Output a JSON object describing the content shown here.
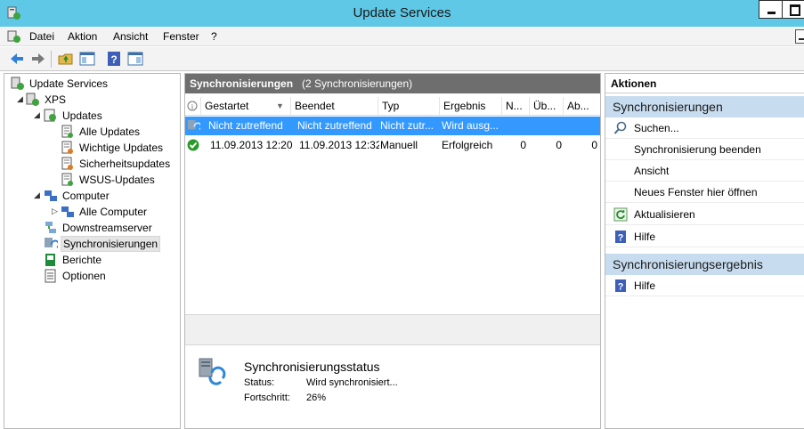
{
  "window": {
    "title": "Update Services"
  },
  "menu": [
    "Datei",
    "Aktion",
    "Ansicht",
    "Fenster",
    "?"
  ],
  "tree": {
    "root": "Update Services",
    "server": "XPS",
    "updates": "Updates",
    "update_children": [
      "Alle Updates",
      "Wichtige Updates",
      "Sicherheitsupdates",
      "WSUS-Updates"
    ],
    "computer": "Computer",
    "computer_children": [
      "Alle Computer"
    ],
    "downstream": "Downstreamserver",
    "sync": "Synchronisierungen",
    "reports": "Berichte",
    "options": "Optionen"
  },
  "center": {
    "title": "Synchronisierungen",
    "count": "(2 Synchronisierungen)",
    "columns": [
      "Gestartet",
      "Beendet",
      "Typ",
      "Ergebnis",
      "N...",
      "Üb...",
      "Ab..."
    ],
    "rows": [
      {
        "started": "Nicht zutreffend",
        "ended": "Nicht zutreffend",
        "type": "Nicht zutr...",
        "result": "Wird ausg...",
        "n": "",
        "ub": "",
        "ab": "",
        "selected": true
      },
      {
        "started": "11.09.2013 12:20",
        "ended": "11.09.2013 12:32",
        "type": "Manuell",
        "result": "Erfolgreich",
        "n": "0",
        "ub": "0",
        "ab": "0",
        "selected": false
      }
    ],
    "status": {
      "title": "Synchronisierungsstatus",
      "status_label": "Status:",
      "status_value": "Wird synchronisiert...",
      "progress_label": "Fortschritt:",
      "progress_value": "26%"
    }
  },
  "actions": {
    "header": "Aktionen",
    "section1": "Synchronisierungen",
    "items1": [
      "Suchen...",
      "Synchronisierung beenden",
      "Ansicht",
      "Neues Fenster hier öffnen",
      "Aktualisieren",
      "Hilfe"
    ],
    "section2": "Synchronisierungsergebnis",
    "items2": [
      "Hilfe"
    ]
  },
  "colors": {
    "titlebar": "#5ec8e6",
    "selection": "#3399ff",
    "pane_header": "#6e6e6e",
    "action_section": "#c7dcef"
  }
}
